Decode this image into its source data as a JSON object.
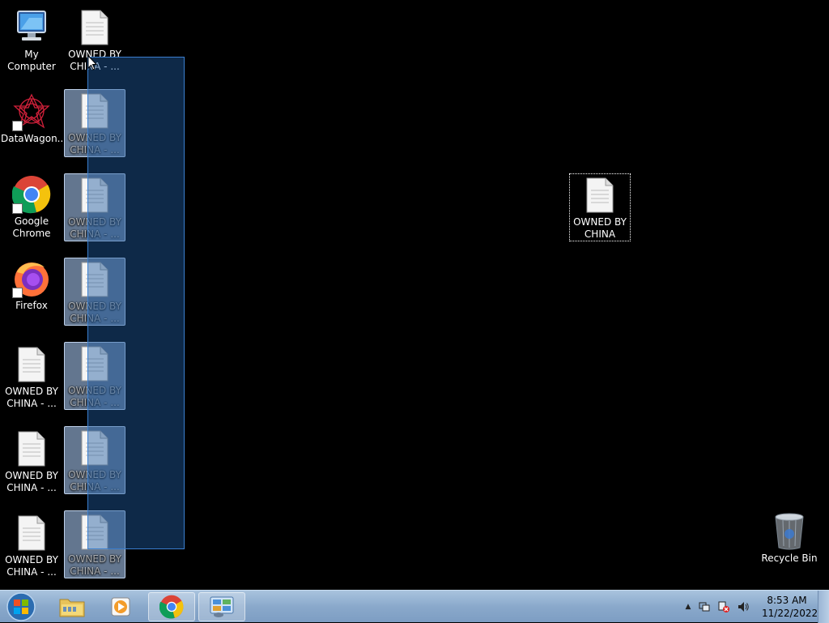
{
  "desktop": {
    "icons": {
      "my_computer": "My Computer",
      "datawagon": "DataWagon...",
      "chrome": "Google Chrome",
      "firefox": "Firefox",
      "recycle_bin": "Recycle Bin",
      "file_truncated": "OWNED BY CHINA - ...",
      "file_full": "OWNED BY CHINA"
    }
  },
  "taskbar": {
    "clock_time": "8:53 AM",
    "clock_date": "11/22/2022"
  },
  "colors": {
    "desktop_bg": "#000000",
    "selection": "#3b7fcf",
    "taskbar": "#8aa9cb"
  }
}
